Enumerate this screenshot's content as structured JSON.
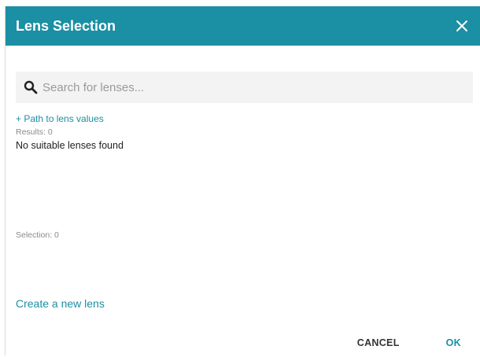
{
  "dialog": {
    "title": "Lens Selection",
    "close_icon": "close-icon"
  },
  "search": {
    "icon": "search-icon",
    "placeholder": "Search for lenses...",
    "value": ""
  },
  "path_link": "+ Path to lens values",
  "results": {
    "label": "Results: 0",
    "empty_message": "No suitable lenses found"
  },
  "selection": {
    "label": "Selection: 0"
  },
  "create_link": "Create a new lens",
  "footer": {
    "cancel_label": "CANCEL",
    "ok_label": "OK"
  },
  "colors": {
    "accent": "#1b8fa3",
    "header_text": "#ffffff",
    "search_bg": "#f3f3f3"
  }
}
